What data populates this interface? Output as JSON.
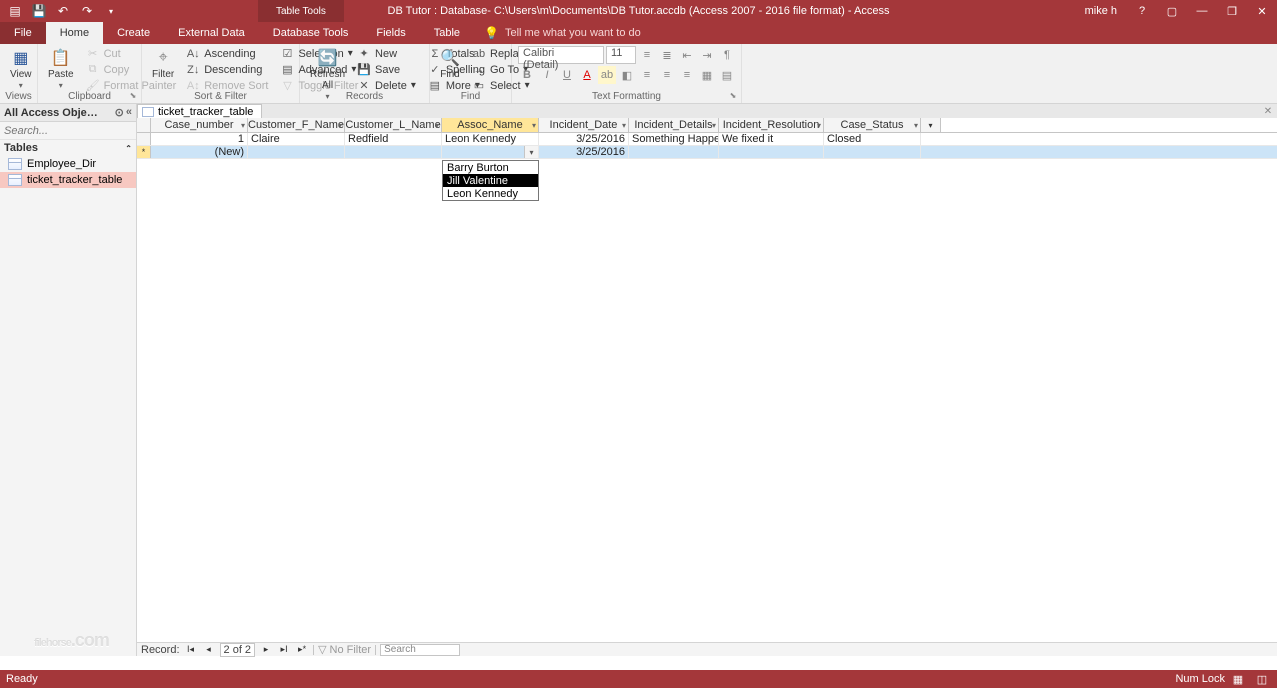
{
  "titlebar": {
    "ctx_group": "Table Tools",
    "title": "DB Tutor : Database- C:\\Users\\m\\Documents\\DB Tutor.accdb (Access 2007 - 2016 file format) - Access",
    "user": "mike h"
  },
  "tabs": {
    "file": "File",
    "home": "Home",
    "create": "Create",
    "external": "External Data",
    "dbtools": "Database Tools",
    "fields": "Fields",
    "table": "Table",
    "tellme": "Tell me what you want to do"
  },
  "ribbon": {
    "views": {
      "label": "Views",
      "view": "View"
    },
    "clipboard": {
      "label": "Clipboard",
      "paste": "Paste",
      "cut": "Cut",
      "copy": "Copy",
      "painter": "Format Painter"
    },
    "sortfilter": {
      "label": "Sort & Filter",
      "filter": "Filter",
      "asc": "Ascending",
      "desc": "Descending",
      "remove": "Remove Sort",
      "selection": "Selection",
      "advanced": "Advanced",
      "toggle": "Toggle Filter"
    },
    "records": {
      "label": "Records",
      "refresh": "Refresh\nAll",
      "new": "New",
      "save": "Save",
      "delete": "Delete",
      "totals": "Totals",
      "spelling": "Spelling",
      "more": "More"
    },
    "find": {
      "label": "Find",
      "find": "Find",
      "replace": "Replace",
      "goto": "Go To",
      "select": "Select"
    },
    "textfmt": {
      "label": "Text Formatting",
      "font": "Calibri (Detail)",
      "size": "11"
    }
  },
  "nav": {
    "header": "All Access Obje…",
    "search_ph": "Search...",
    "group": "Tables",
    "items": [
      "Employee_Dir",
      "ticket_tracker_table"
    ],
    "selected": 1
  },
  "doc": {
    "tab": "ticket_tracker_table"
  },
  "columns": [
    "Case_number",
    "Customer_F_Name",
    "Customer_L_Name",
    "Assoc_Name",
    "Incident_Date",
    "Incident_Details",
    "Incident_Resolution",
    "Case_Status"
  ],
  "active_col": 3,
  "rows": [
    {
      "case": "1",
      "fname": "Claire",
      "lname": "Redfield",
      "assoc": "Leon Kennedy",
      "date": "3/25/2016",
      "details": "Something Happene",
      "res": "We fixed it",
      "status": "Closed"
    },
    {
      "new": true,
      "case": "(New)",
      "fname": "",
      "lname": "",
      "assoc": "",
      "date": "3/25/2016",
      "details": "",
      "res": "",
      "status": ""
    }
  ],
  "dropdown": {
    "options": [
      "Barry Burton",
      "Jill Valentine",
      "Leon Kennedy"
    ],
    "highlight": 1
  },
  "recnav": {
    "label": "Record:",
    "pos": "2 of 2",
    "nofilter": "No Filter",
    "search": "Search"
  },
  "status": {
    "left": "Ready",
    "numlock": "Num Lock"
  },
  "watermark": {
    "main": "filehorse",
    "sub": ".com"
  }
}
